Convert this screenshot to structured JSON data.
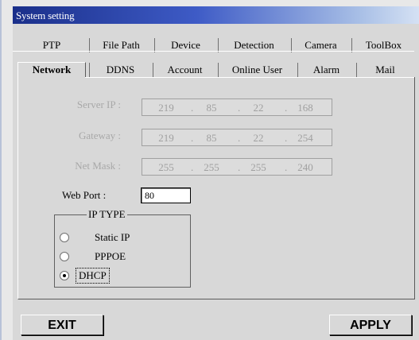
{
  "window": {
    "title": "System setting"
  },
  "tabs_back": [
    "PTP",
    "File Path",
    "Device",
    "Detection",
    "Camera",
    "ToolBox"
  ],
  "tabs_front": [
    "Network",
    "DDNS",
    "Account",
    "Online User",
    "Alarm",
    "Mail"
  ],
  "selected_tab": "Network",
  "network": {
    "server_ip": {
      "label": "Server IP :",
      "octets": [
        "219",
        "85",
        "22",
        "168"
      ]
    },
    "gateway": {
      "label": "Gateway :",
      "octets": [
        "219",
        "85",
        "22",
        "254"
      ]
    },
    "net_mask": {
      "label": "Net Mask :",
      "octets": [
        "255",
        "255",
        "255",
        "240"
      ]
    },
    "web_port": {
      "label": "Web Port :",
      "value": "80"
    },
    "ip_type": {
      "legend": "IP TYPE",
      "options": [
        "Static IP",
        "PPPOE",
        "DHCP"
      ],
      "selected": "DHCP"
    }
  },
  "buttons": {
    "exit": "EXIT",
    "apply": "APPLY"
  }
}
